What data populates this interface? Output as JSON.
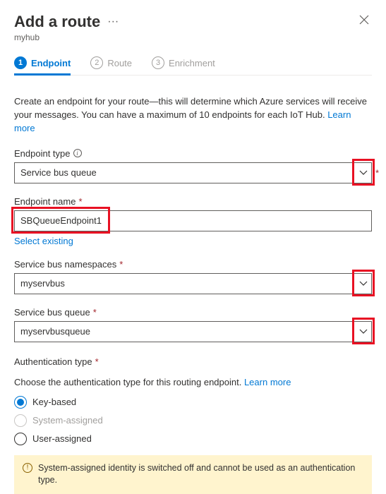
{
  "header": {
    "title": "Add a route",
    "subtitle": "myhub"
  },
  "steps": [
    {
      "num": "1",
      "label": "Endpoint",
      "active": true
    },
    {
      "num": "2",
      "label": "Route",
      "active": false
    },
    {
      "num": "3",
      "label": "Enrichment",
      "active": false
    }
  ],
  "description": "Create an endpoint for your route—this will determine which Azure services will receive your messages. You can have a maximum of 10 endpoints for each IoT Hub.",
  "learn_more": "Learn more",
  "fields": {
    "endpoint_type": {
      "label": "Endpoint type",
      "value": "Service bus queue"
    },
    "endpoint_name": {
      "label": "Endpoint name",
      "value": "SBQueueEndpoint1",
      "select_existing": "Select existing"
    },
    "sb_namespaces": {
      "label": "Service bus namespaces",
      "value": "myservbus"
    },
    "sb_queue": {
      "label": "Service bus queue",
      "value": "myservbusqueue"
    },
    "auth_type": {
      "label": "Authentication type"
    }
  },
  "auth": {
    "desc": "Choose the authentication type for this routing endpoint.",
    "options": {
      "key": "Key-based",
      "system": "System-assigned",
      "user": "User-assigned"
    }
  },
  "warning": "System-assigned identity is switched off and cannot be used as an authentication type."
}
